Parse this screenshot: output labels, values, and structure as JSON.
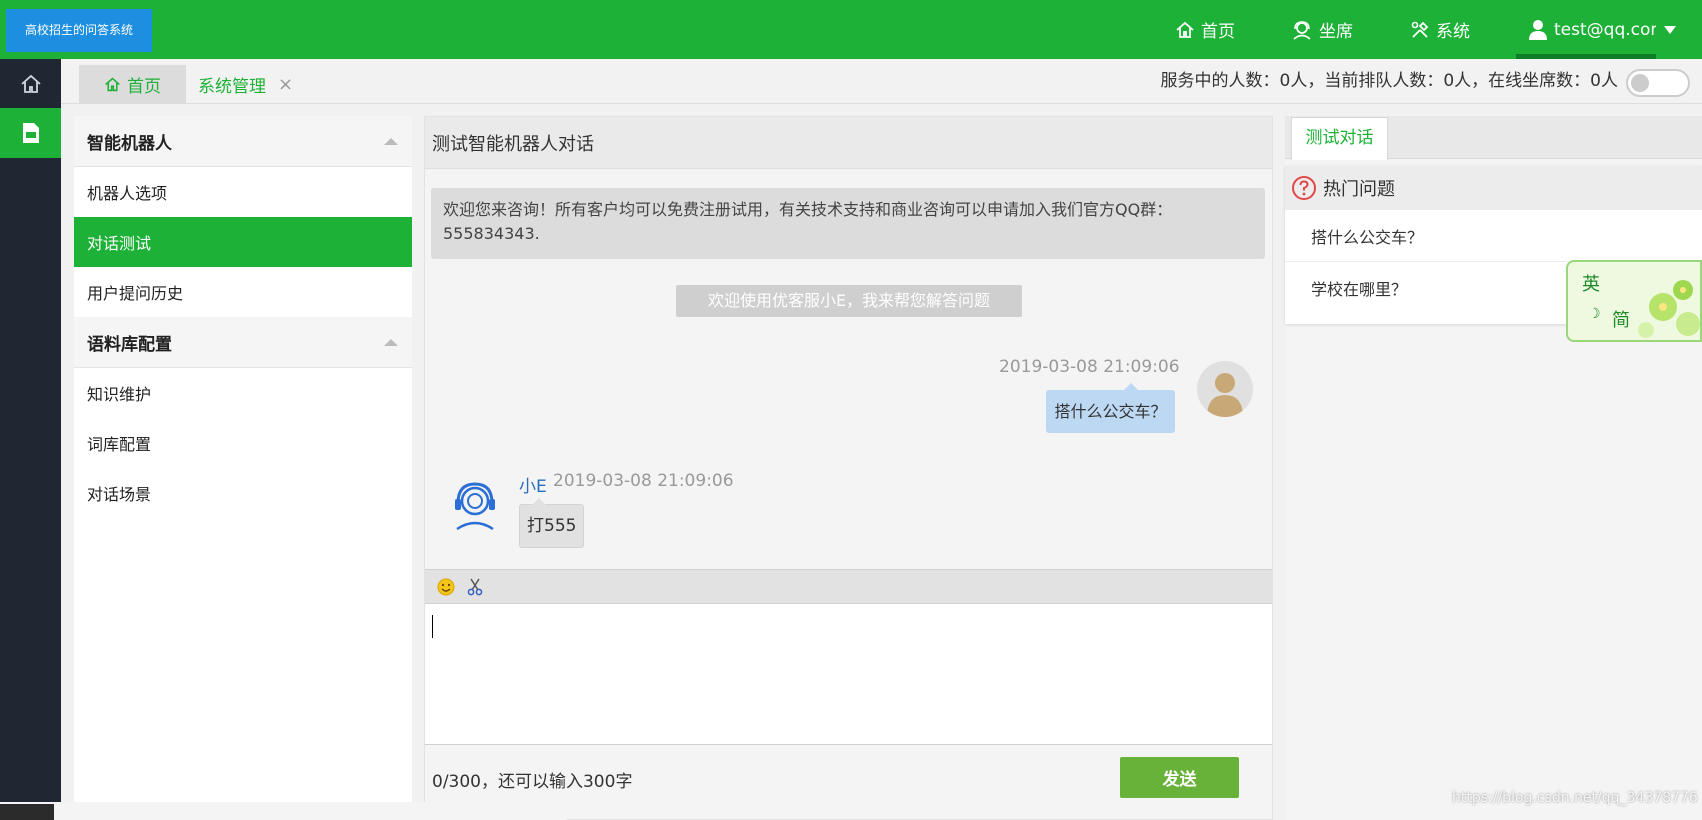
{
  "app": {
    "logo_text": "高校招生的问答系统"
  },
  "topnav": {
    "home": "首页",
    "seats": "坐席",
    "system": "系统",
    "user": "test@qq.com"
  },
  "tabs": {
    "home": "首页",
    "system_mgmt": "系统管理",
    "close_glyph": "×"
  },
  "status": {
    "text": "服务中的人数：0人，当前排队人数：0人，在线坐席数：0人"
  },
  "menu": {
    "groups": [
      {
        "title": "智能机器人",
        "items": [
          "机器人选项",
          "对话测试",
          "用户提问历史"
        ]
      },
      {
        "title": "语料库配置",
        "items": [
          "知识维护",
          "词库配置",
          "对话场景"
        ]
      }
    ],
    "active_item": "对话测试"
  },
  "chat": {
    "title": "测试智能机器人对话",
    "welcome": "欢迎您来咨询！所有客户均可以免费注册试用，有关技术支持和商业咨询可以申请加入我们官方QQ群：555834343.",
    "system_tip": "欢迎使用优客服小E，我来帮您解答问题",
    "user_msg": {
      "time": "2019-03-08 21:09:06",
      "text": "搭什么公交车？"
    },
    "bot_msg": {
      "name": "小E",
      "time": "2019-03-08 21:09:06",
      "text": "打555"
    },
    "counter": "0/300，还可以输入300字",
    "send_label": "发送"
  },
  "right": {
    "tab": "测试对话",
    "hot_title": "热门问题",
    "hot_items": [
      "搭什么公交车？",
      "学校在哪里？"
    ]
  },
  "float_widget": {
    "char1": "英",
    "char2": "简"
  },
  "watermark": "https://blog.csdn.net/qq_34378776",
  "colors": {
    "brand_green": "#1eb137",
    "rail_dark": "#1f2733",
    "send_green": "#69b23a",
    "user_bubble": "#bcd8f3"
  },
  "icons": [
    "home-icon",
    "headset-icon",
    "tools-icon",
    "user-icon",
    "chevron-down-icon",
    "document-icon",
    "question-icon",
    "smiley-icon",
    "scissors-icon"
  ]
}
